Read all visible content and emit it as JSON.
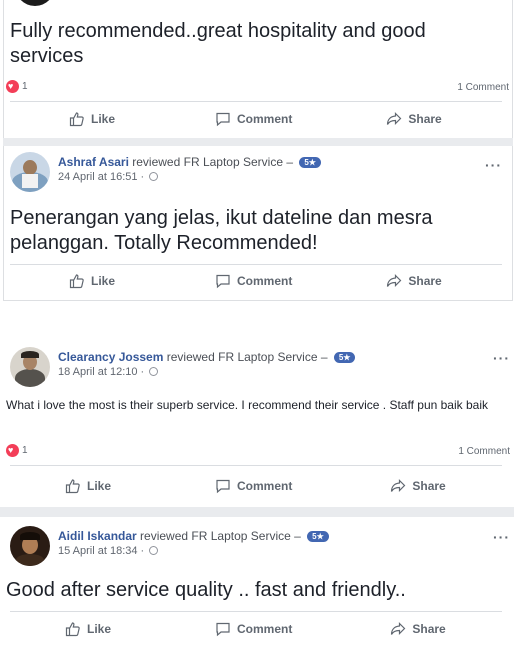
{
  "posts": [
    {
      "text": "Fully recommended..great hospitality and good services",
      "reactions": "1",
      "comments": "1 Comment"
    },
    {
      "reviewer": "Ashraf Asari",
      "action": " reviewed ",
      "page": "FR Laptop Service",
      "dash": " – ",
      "rating": "5★",
      "timestamp": "24 April at 16:51 · ",
      "text": "Penerangan yang jelas, ikut dateline dan mesra pelanggan. Totally Recommended!"
    },
    {
      "reviewer": "Clearancy Jossem",
      "action": " reviewed ",
      "page": "FR Laptop Service",
      "dash": " – ",
      "rating": "5★",
      "timestamp": "18 April at 12:10 · ",
      "text": "What i love the most is their superb service. I recommend their service . Staff pun baik baik",
      "reactions": "1",
      "comments": "1 Comment"
    },
    {
      "reviewer": "Aidil Iskandar",
      "action": " reviewed ",
      "page": "FR Laptop Service",
      "dash": " – ",
      "rating": "5★",
      "timestamp": "15 April at 18:34 · ",
      "text": "Good after service quality .. fast and friendly.."
    }
  ],
  "actions": {
    "like": "Like",
    "comment": "Comment",
    "share": "Share"
  },
  "more": "···",
  "colors": {
    "link": "#365899",
    "heart": "#f33e58",
    "badge": "#4267b2"
  }
}
